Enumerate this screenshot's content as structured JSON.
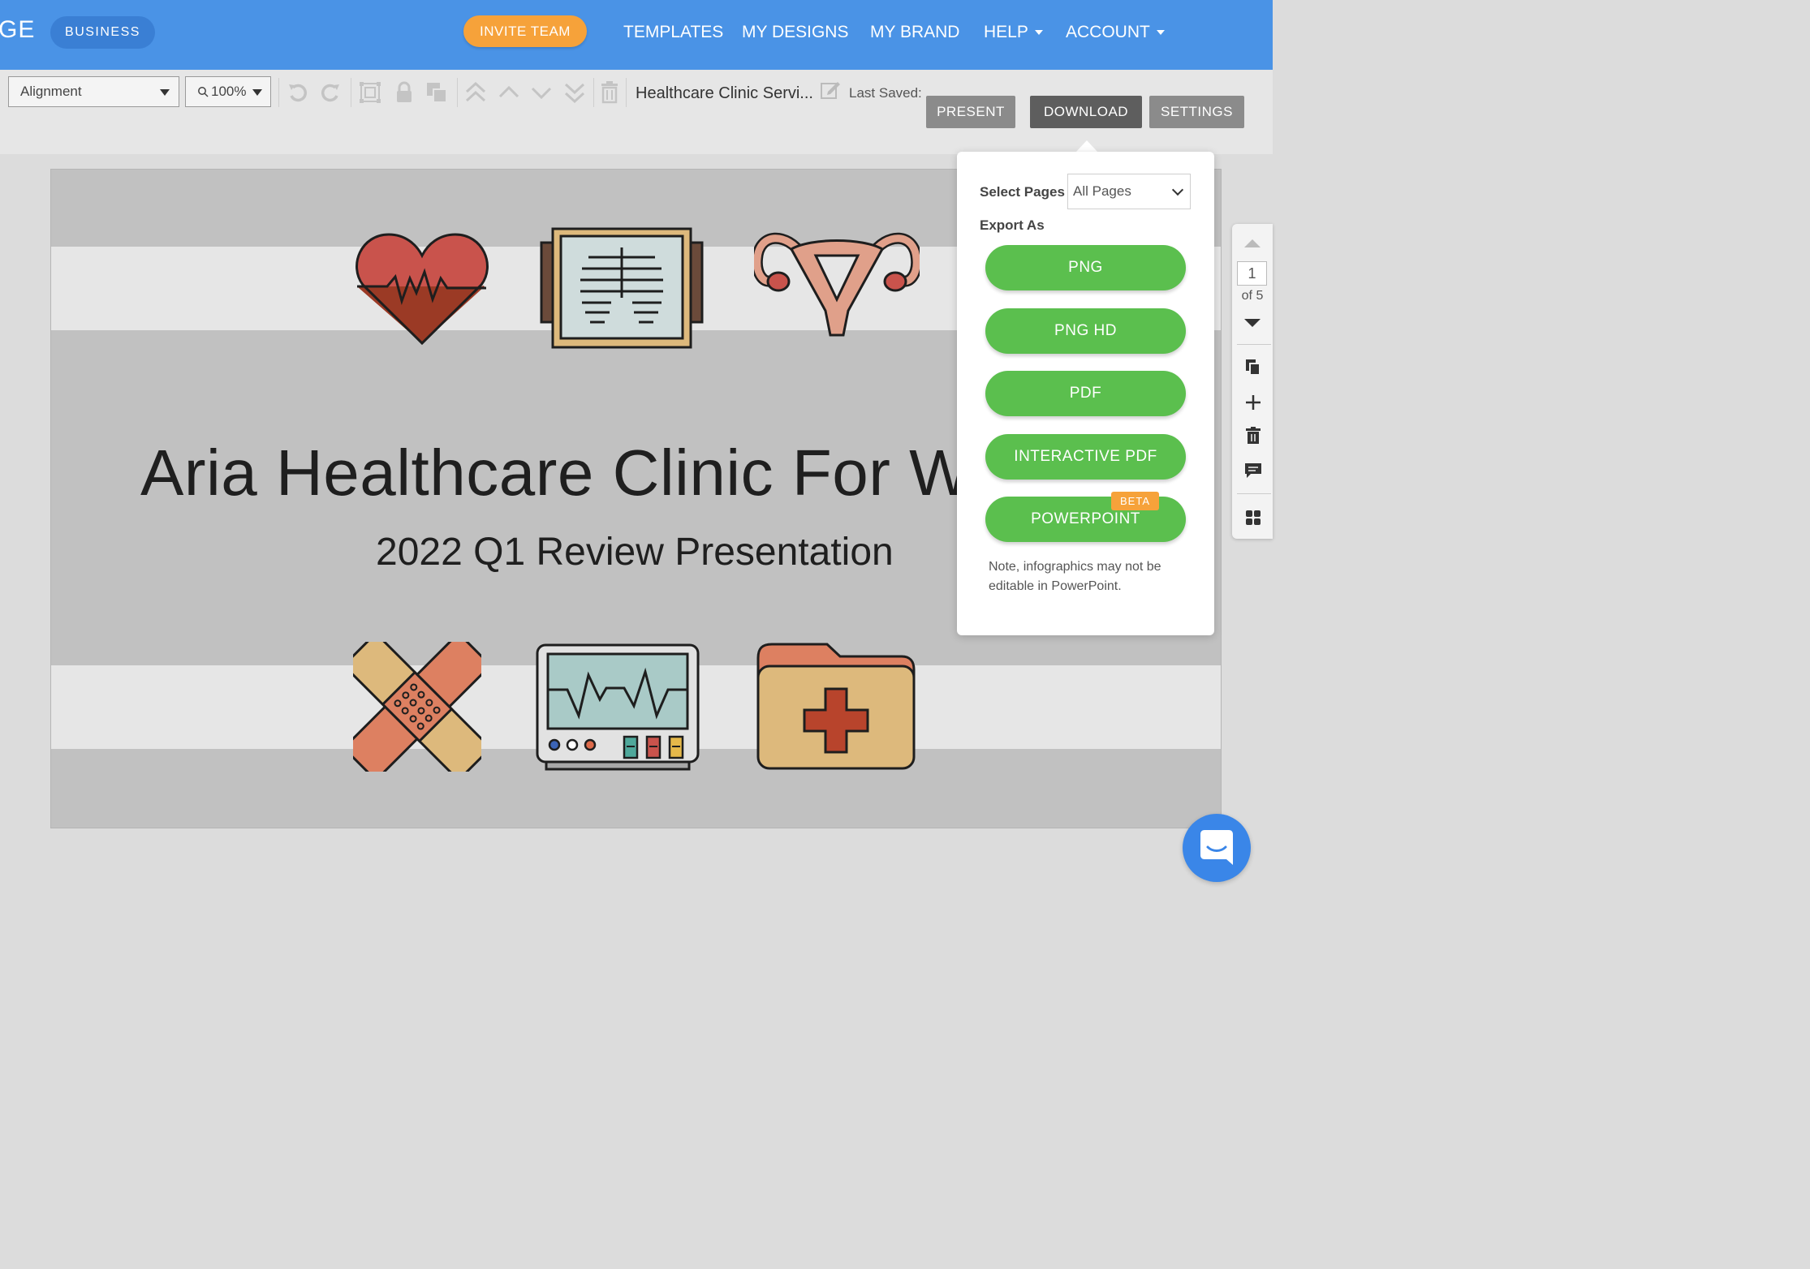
{
  "nav": {
    "logo_fragment": "GE",
    "plan_badge": "BUSINESS",
    "invite_button": "INVITE TEAM",
    "links": [
      "TEMPLATES",
      "MY DESIGNS",
      "MY BRAND",
      "HELP",
      "ACCOUNT"
    ]
  },
  "toolbar": {
    "alignment_select": "Alignment",
    "zoom_select": "100%",
    "document_title": "Healthcare Clinic Servi...",
    "last_saved_label": "Last Saved:",
    "present_button": "PRESENT",
    "download_button": "DOWNLOAD",
    "settings_button": "SETTINGS"
  },
  "canvas": {
    "title": "Aria Healthcare Clinic For W",
    "subtitle": "2022 Q1 Review Presentation",
    "icons": [
      "heart-rate-icon",
      "xray-icon",
      "uterus-icon",
      "bandage-icon",
      "heart-monitor-icon",
      "medical-folder-icon"
    ]
  },
  "download_panel": {
    "select_pages_label": "Select Pages",
    "select_pages_value": "All Pages",
    "export_as_label": "Export As",
    "buttons": [
      "PNG",
      "PNG HD",
      "PDF",
      "INTERACTIVE PDF",
      "POWERPOINT"
    ],
    "beta_badge": "BETA",
    "note": "Note, infographics may not be editable in PowerPoint."
  },
  "page_panel": {
    "current_page": "1",
    "page_of": "of 5"
  },
  "colors": {
    "nav_blue": "#4a93e6",
    "invite_orange": "#f6a23a",
    "export_green": "#5bbf4e",
    "canvas_gray": "#c1c1c1"
  }
}
